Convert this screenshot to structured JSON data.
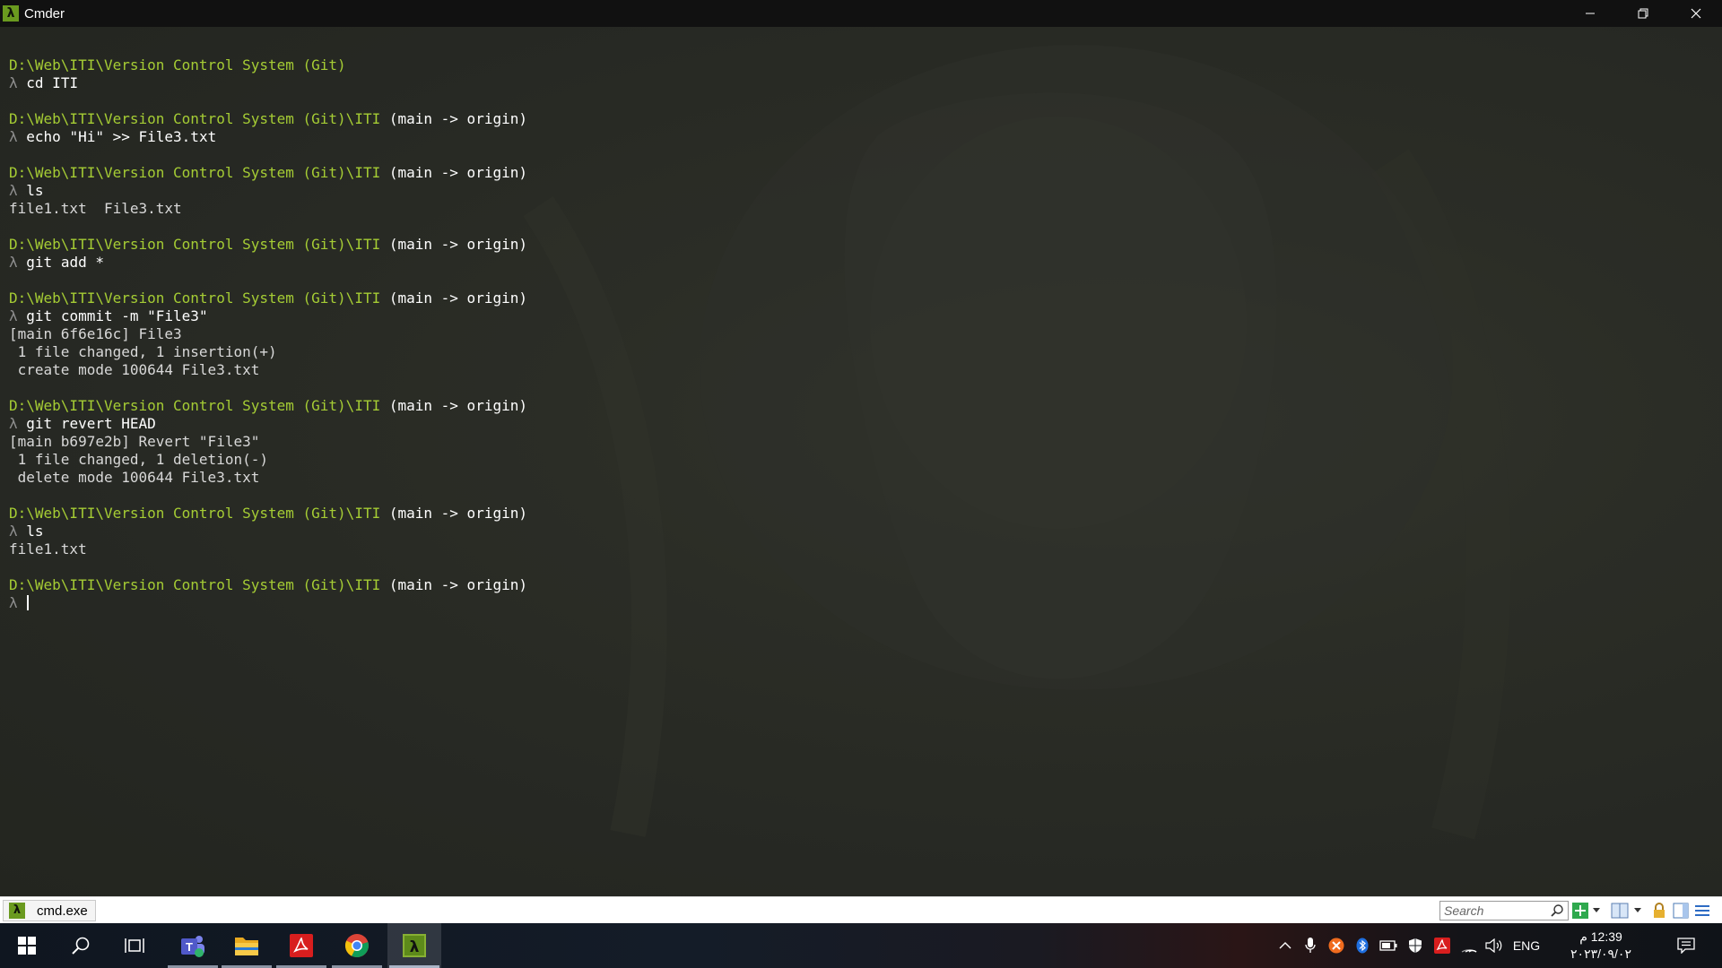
{
  "window": {
    "title": "Cmder",
    "app_icon_glyph": "λ",
    "controls": [
      "minimize-icon",
      "restore-icon",
      "close-icon"
    ]
  },
  "terminal": {
    "lines": [
      {
        "type": "prompt",
        "path": "D:\\Web\\ITI\\Version Control System (Git)",
        "branch": ""
      },
      {
        "type": "command",
        "lambda": "λ",
        "text": "cd ITI"
      },
      {
        "type": "blank"
      },
      {
        "type": "prompt",
        "path": "D:\\Web\\ITI\\Version Control System (Git)\\ITI",
        "branch": "(main -> origin)"
      },
      {
        "type": "command",
        "lambda": "λ",
        "text": "echo \"Hi\" >> File3.txt"
      },
      {
        "type": "blank"
      },
      {
        "type": "prompt",
        "path": "D:\\Web\\ITI\\Version Control System (Git)\\ITI",
        "branch": "(main -> origin)"
      },
      {
        "type": "command",
        "lambda": "λ",
        "text": "ls"
      },
      {
        "type": "output",
        "text": "file1.txt  File3.txt"
      },
      {
        "type": "blank"
      },
      {
        "type": "prompt",
        "path": "D:\\Web\\ITI\\Version Control System (Git)\\ITI",
        "branch": "(main -> origin)"
      },
      {
        "type": "command",
        "lambda": "λ",
        "text": "git add *"
      },
      {
        "type": "blank"
      },
      {
        "type": "prompt",
        "path": "D:\\Web\\ITI\\Version Control System (Git)\\ITI",
        "branch": "(main -> origin)"
      },
      {
        "type": "command",
        "lambda": "λ",
        "text": "git commit -m \"File3\""
      },
      {
        "type": "output",
        "text": "[main 6f6e16c] File3"
      },
      {
        "type": "output",
        "text": " 1 file changed, 1 insertion(+)"
      },
      {
        "type": "output",
        "text": " create mode 100644 File3.txt"
      },
      {
        "type": "blank"
      },
      {
        "type": "prompt",
        "path": "D:\\Web\\ITI\\Version Control System (Git)\\ITI",
        "branch": "(main -> origin)"
      },
      {
        "type": "command",
        "lambda": "λ",
        "text": "git revert HEAD"
      },
      {
        "type": "output",
        "text": "[main b697e2b] Revert \"File3\""
      },
      {
        "type": "output",
        "text": " 1 file changed, 1 deletion(-)"
      },
      {
        "type": "output",
        "text": " delete mode 100644 File3.txt"
      },
      {
        "type": "blank"
      },
      {
        "type": "prompt",
        "path": "D:\\Web\\ITI\\Version Control System (Git)\\ITI",
        "branch": "(main -> origin)"
      },
      {
        "type": "command",
        "lambda": "λ",
        "text": "ls"
      },
      {
        "type": "output",
        "text": "file1.txt"
      },
      {
        "type": "blank"
      },
      {
        "type": "prompt",
        "path": "D:\\Web\\ITI\\Version Control System (Git)\\ITI",
        "branch": "(main -> origin)"
      },
      {
        "type": "input",
        "lambda": "λ",
        "text": ""
      }
    ]
  },
  "tabbar": {
    "tab_label": "cmd.exe",
    "tab_icon_glyph": "λ",
    "search_placeholder": "Search"
  },
  "taskbar": {
    "apps": [
      {
        "name": "start-button",
        "icon": "windows-logo-icon"
      },
      {
        "name": "search-button",
        "icon": "search-icon"
      },
      {
        "name": "task-view-button",
        "icon": "task-view-icon"
      },
      {
        "name": "taskbar-teams",
        "icon": "teams-icon"
      },
      {
        "name": "taskbar-file-explorer",
        "icon": "folder-icon"
      },
      {
        "name": "taskbar-acrobat",
        "icon": "acrobat-icon"
      },
      {
        "name": "taskbar-chrome",
        "icon": "chrome-icon"
      },
      {
        "name": "taskbar-cmder",
        "icon": "cmder-icon"
      }
    ],
    "language": "ENG",
    "time": "12:39 م",
    "date": "٢٠٢٣/٠٩/٠٢"
  },
  "colors": {
    "path": "#a5cc34",
    "branch": "#ffffff",
    "lambda": "#8e8e8e",
    "terminal_bg": "#272822",
    "accent_green": "#6a9a1f"
  }
}
